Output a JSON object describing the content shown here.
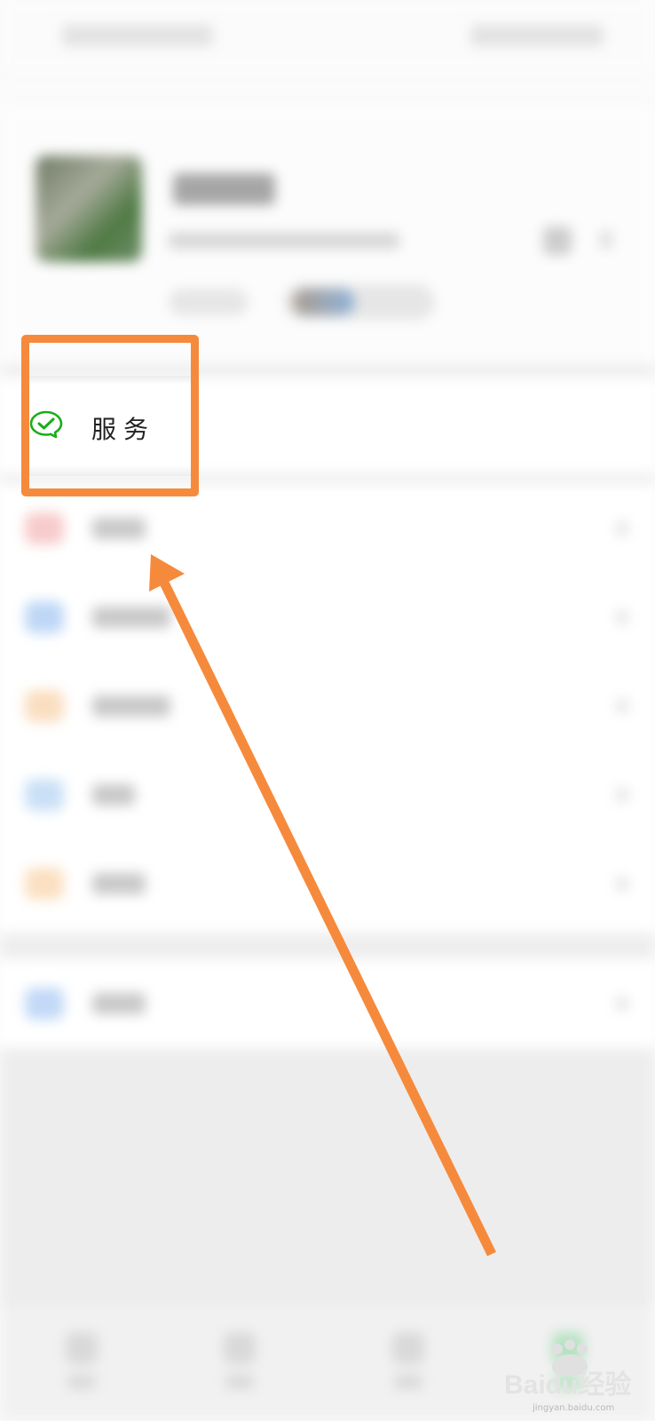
{
  "service": {
    "label": "服务",
    "icon": "wechat-pay-icon"
  },
  "annotation": {
    "highlight_color": "#f68a3c",
    "pointer": "arrow-pointing-to-service"
  },
  "watermark": {
    "brand": "Baidu经验",
    "url": "jingyan.baidu.com"
  },
  "colors": {
    "wechat_green": "#1aad19",
    "background": "#ededed"
  }
}
